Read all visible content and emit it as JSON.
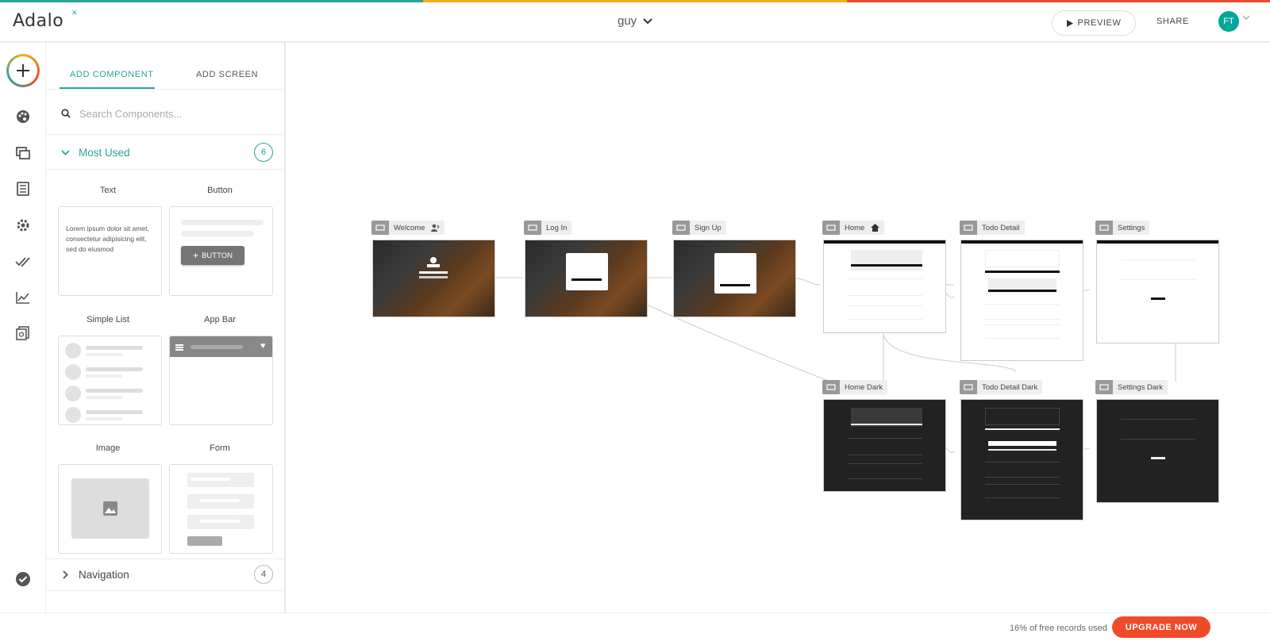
{
  "brand": {
    "logo_text": "Adalo",
    "stripe_colors": [
      "#26a69a",
      "#f2b01e",
      "#eb4d2b"
    ]
  },
  "header": {
    "app_name": "guy",
    "preview_label": "PREVIEW",
    "share_label": "SHARE",
    "avatar_initials": "FT"
  },
  "panel": {
    "tabs": [
      {
        "label": "ADD COMPONENT",
        "active": true
      },
      {
        "label": "ADD SCREEN",
        "active": false
      }
    ],
    "search_placeholder": "Search Components...",
    "sections": [
      {
        "title": "Most Used",
        "count": "6",
        "expanded": true
      },
      {
        "title": "Navigation",
        "count": "4",
        "expanded": false
      }
    ],
    "components": [
      {
        "label": "Text",
        "preview_text": "Lorem ipsum dolor sit amet, consectetur adipisicing elit, sed do eiusmod"
      },
      {
        "label": "Button",
        "preview_text": "BUTTON"
      },
      {
        "label": "Simple List"
      },
      {
        "label": "App Bar"
      },
      {
        "label": "Image"
      },
      {
        "label": "Form"
      }
    ]
  },
  "canvas": {
    "screens": [
      {
        "name": "Welcome",
        "style": "photo",
        "badge": "user-icon"
      },
      {
        "name": "Log In",
        "style": "photo"
      },
      {
        "name": "Sign Up",
        "style": "photo"
      },
      {
        "name": "Home",
        "style": "white",
        "badge": "home-icon"
      },
      {
        "name": "Todo Detail",
        "style": "white"
      },
      {
        "name": "Settings",
        "style": "white"
      },
      {
        "name": "Home Dark",
        "style": "dark"
      },
      {
        "name": "Todo Detail Dark",
        "style": "dark"
      },
      {
        "name": "Settings Dark",
        "style": "dark"
      }
    ]
  },
  "footer": {
    "records_text": "16% of free records used",
    "upgrade_label": "UPGRADE NOW"
  }
}
